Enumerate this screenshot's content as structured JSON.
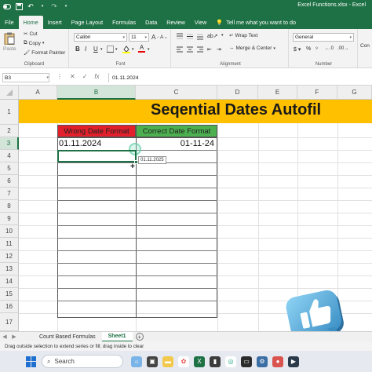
{
  "window": {
    "title": "Excel Functions.xlsx - Excel",
    "save_icon": "save-icon",
    "undo_icon": "undo-icon"
  },
  "tabs": [
    {
      "label": "File"
    },
    {
      "label": "Home"
    },
    {
      "label": "Insert"
    },
    {
      "label": "Page Layout"
    },
    {
      "label": "Formulas"
    },
    {
      "label": "Data"
    },
    {
      "label": "Review"
    },
    {
      "label": "View"
    }
  ],
  "tell_me": "Tell me what you want to do",
  "ribbon": {
    "clipboard": {
      "paste": "Paste",
      "cut": "Cut",
      "copy": "Copy",
      "format_painter": "Format Painter",
      "label": "Clipboard"
    },
    "font": {
      "name": "Calibri",
      "size": "11",
      "label": "Font"
    },
    "alignment": {
      "wrap_text": "Wrap Text",
      "merge_center": "Merge & Center",
      "label": "Alignment"
    },
    "number": {
      "format": "General",
      "label": "Number"
    },
    "extra": "Con"
  },
  "formula_bar": {
    "name_box": "B3",
    "value": "01.11.2024"
  },
  "columns": [
    "A",
    "B",
    "C",
    "D",
    "E",
    "F",
    "G"
  ],
  "rows": [
    "1",
    "2",
    "3",
    "4",
    "5",
    "6",
    "7",
    "8",
    "9",
    "10",
    "11",
    "12",
    "13",
    "14",
    "15",
    "16",
    "17"
  ],
  "sheet": {
    "title": "Seqential Dates Autofil",
    "wrong_header": "Wrong Date Format",
    "correct_header": "Correct Date Format",
    "b3": "01.11.2024",
    "c3": "01-11-24",
    "fill_tooltip": "01.11.2025"
  },
  "sheet_tabs": [
    {
      "label": "Count Based Formulas"
    },
    {
      "label": "Sheet1"
    }
  ],
  "status": "Drag outside selection to extend series or fill; drag inside to clear",
  "taskbar": {
    "search": "Search"
  },
  "colors": {
    "excel_green": "#1e7145",
    "banner": "#ffc000",
    "wrong": "#e1202c",
    "correct": "#4caf50"
  }
}
